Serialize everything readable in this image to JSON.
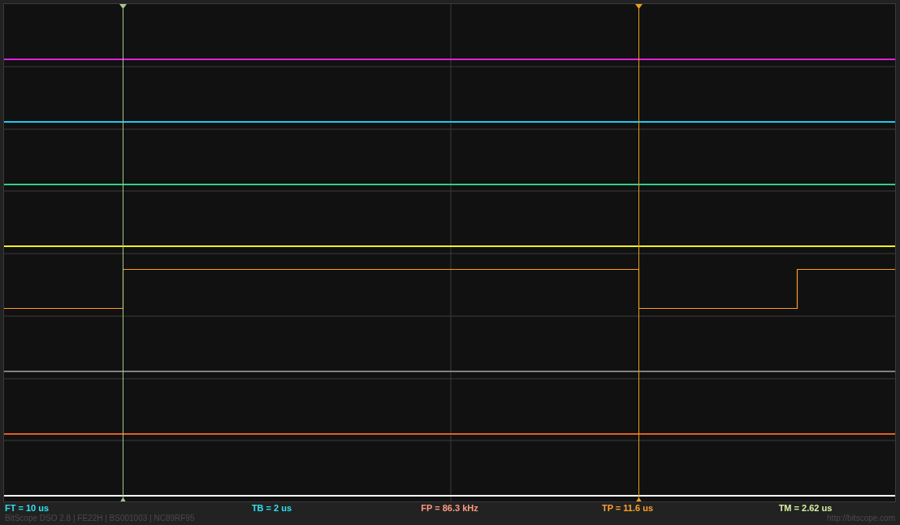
{
  "traces": [
    {
      "kind": "flat",
      "color": "#e020e0"
    },
    {
      "kind": "flat",
      "color": "#20c8f0"
    },
    {
      "kind": "flat",
      "color": "#30d080"
    },
    {
      "kind": "flat",
      "color": "#f0f020"
    },
    {
      "kind": "square",
      "color": "#ff9a20"
    },
    {
      "kind": "flat",
      "color": "#808080"
    },
    {
      "kind": "flat",
      "color": "#e06020"
    },
    {
      "kind": "flat",
      "color": "#ffffff"
    }
  ],
  "cursors": [
    {
      "color": "#a8c890"
    },
    {
      "color": "#e8a020"
    }
  ],
  "measurements": [
    {
      "text": "FT = 10 us",
      "color": "#30e0f0"
    },
    {
      "text": "TB = 2 us",
      "color": "#30e0f0"
    },
    {
      "text": "FP = 86.3 kHz",
      "color": "#ff9a80"
    },
    {
      "text": "TP = 11.6 us",
      "color": "#ffa030"
    },
    {
      "text": "TM = 2.62 us",
      "color": "#d8f0a0"
    }
  ],
  "footer": {
    "info": "BitScope DSO 2.8 | FE22H | BS001003 | NC89RF95",
    "link": "http://bitscope.com"
  }
}
